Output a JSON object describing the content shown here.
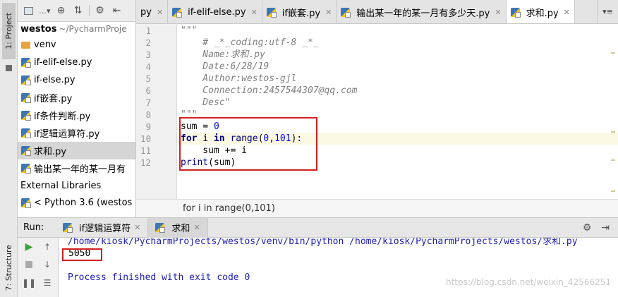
{
  "left_strip": {
    "project_tab": "1: Project",
    "structure_tab": "7: Structure"
  },
  "project": {
    "root_name": "westos",
    "root_path": "~/PycharmProje",
    "items": [
      {
        "label": "venv",
        "type": "folder"
      },
      {
        "label": "if-elif-else.py",
        "type": "py"
      },
      {
        "label": "if-else.py",
        "type": "py"
      },
      {
        "label": "if嵌套.py",
        "type": "py"
      },
      {
        "label": "if条件判断.py",
        "type": "py"
      },
      {
        "label": "if逻辑运算符.py",
        "type": "py"
      },
      {
        "label": "求和.py",
        "type": "py",
        "selected": true
      },
      {
        "label": "输出某一年的某一月有",
        "type": "py"
      }
    ],
    "external_libraries": "External Libraries",
    "python_sdk": "< Python 3.6 (westos"
  },
  "tabs": [
    {
      "label": "py"
    },
    {
      "label": "if-elif-else.py"
    },
    {
      "label": "if嵌套.py"
    },
    {
      "label": "输出某一年的某一月有多少天.py"
    },
    {
      "label": "求和.py",
      "active": true
    }
  ],
  "tab_menu": "▾≡",
  "editor": {
    "line_numbers": [
      "1",
      "2",
      "3",
      "4",
      "5",
      "6",
      "7",
      "8",
      "9",
      "10",
      "11",
      "12"
    ],
    "doc_lines": [
      "\"\"\"",
      "    # _*_coding:utf-8 _*_",
      "    Name:求和.py",
      "    Date:6/28/19",
      "    Author:westos-gjl",
      "    Connection:2457544307@qq.com",
      "    Desc\"",
      "\"\"\""
    ],
    "code": {
      "l9_a": "sum = ",
      "l9_num": "0",
      "l10_kw1": "for",
      "l10_mid": " i ",
      "l10_kw2": "in",
      "l10_sp": " ",
      "l10_fn": "range",
      "l10_p1": "(",
      "l10_n1": "0",
      "l10_c": ",",
      "l10_n2": "101",
      "l10_end": "):",
      "l11": "    sum += i",
      "l12_fn": "print",
      "l12_rest": "(sum)"
    },
    "status_breadcrumb": "for i in range(0,101)"
  },
  "run": {
    "label": "Run:",
    "tabs": [
      {
        "label": "if逻辑运算符"
      },
      {
        "label": "求和",
        "active": true
      }
    ],
    "console": {
      "command": "/home/kiosk/PycharmProjects/westos/venv/bin/python /home/kiosk/PycharmProjects/westos/求和.py",
      "output": "5050",
      "exit": "Process finished with exit code 0"
    }
  },
  "watermark": "https://blog.csdn.net/weixin_42566251"
}
